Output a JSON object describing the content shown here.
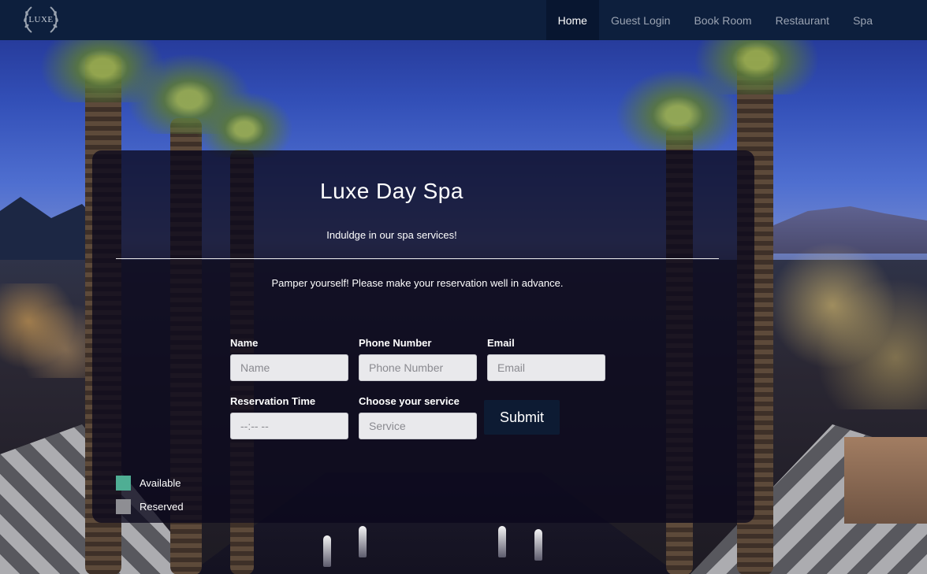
{
  "nav": {
    "logo_text": "LUXE",
    "items": [
      {
        "label": "Home",
        "active": true
      },
      {
        "label": "Guest Login",
        "active": false
      },
      {
        "label": "Book Room",
        "active": false
      },
      {
        "label": "Restaurant",
        "active": false
      },
      {
        "label": "Spa",
        "active": false
      }
    ]
  },
  "card": {
    "title": "Luxe Day Spa",
    "subtitle": "Induldge in our spa services!",
    "note": "Pamper yourself!  Please make your reservation well in advance."
  },
  "form": {
    "name": {
      "label": "Name",
      "placeholder": "Name"
    },
    "phone": {
      "label": "Phone Number",
      "placeholder": "Phone Number"
    },
    "email": {
      "label": "Email",
      "placeholder": "Email"
    },
    "time": {
      "label": "Reservation Time",
      "value": "--:-- --"
    },
    "service": {
      "label": "Choose your service",
      "placeholder": "Service"
    },
    "submit_label": "Submit"
  },
  "legend": [
    {
      "label": "Available",
      "color": "#4fae94"
    },
    {
      "label": "Reserved",
      "color": "#8e8e93"
    }
  ],
  "colors": {
    "navbar": "#0d1f3d",
    "nav_active": "#081630",
    "submit": "#0d1b33"
  }
}
